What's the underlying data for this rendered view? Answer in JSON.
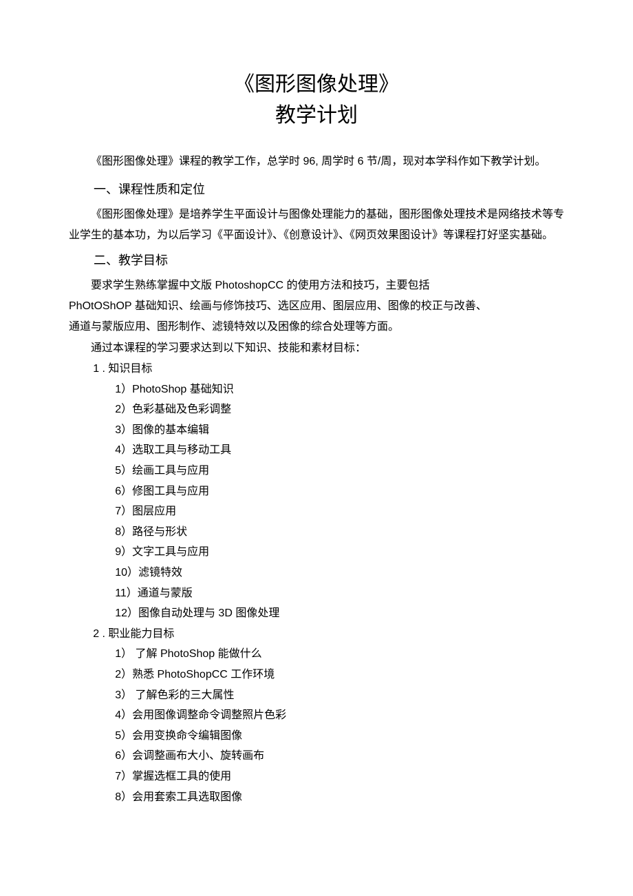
{
  "title": {
    "line1": "《图形图像处理》",
    "line2": "教学计划"
  },
  "intro": "《图形图像处理》课程的教学工作，总学时 96, 周学时 6 节/周，现对本学科作如下教学计划。",
  "section1": {
    "heading": "一、课程性质和定位",
    "body": "《图形图像处理》是培养学生平面设计与图像处理能力的基础，图形图像处理技术是网络技术等专业学生的基本功，为以后学习《平面设计》、《创意设计》、《网页效果图设计》等课程打好坚实基础。"
  },
  "section2": {
    "heading": "二、教学目标",
    "p1": "要求学生熟练掌握中文版 PhotoshopCC 的使用方法和技巧，主要包括",
    "p2": "PhOtOShOP 基础知识、绘画与修饰技巧、选区应用、图层应用、图像的校正与改善、",
    "p3": "通道与蒙版应用、图形制作、滤镜特效以及困像的综合处理等方面。",
    "p4": "通过本课程的学习要求达到以下知识、技能和素材目标："
  },
  "goals": {
    "g1": {
      "label": "1 . 知识目标",
      "items": [
        "1）PhotoShop 基础知识",
        "2）色彩基础及色彩调整",
        "3）图像的基本编辑",
        "4）选取工具与移动工具",
        "5）绘画工具与应用",
        "6）修图工具与应用",
        "7）图层应用",
        "8）路径与形状",
        "9）文字工具与应用",
        "10）滤镜特效",
        "11）通道与蒙版",
        "12）图像自动处理与 3D 图像处理"
      ]
    },
    "g2": {
      "label": "2 . 职业能力目标",
      "items": [
        "1） 了解 PhotoShop 能做什么",
        "2）熟悉 PhotoShopCC 工作环境",
        "3） 了解色彩的三大属性",
        "4）会用图像调整命令调整照片色彩",
        "5）会用变换命令编辑图像",
        "6）会调整画布大小、旋转画布",
        "7）掌握选框工具的使用",
        "8）会用套索工具选取图像"
      ]
    }
  }
}
